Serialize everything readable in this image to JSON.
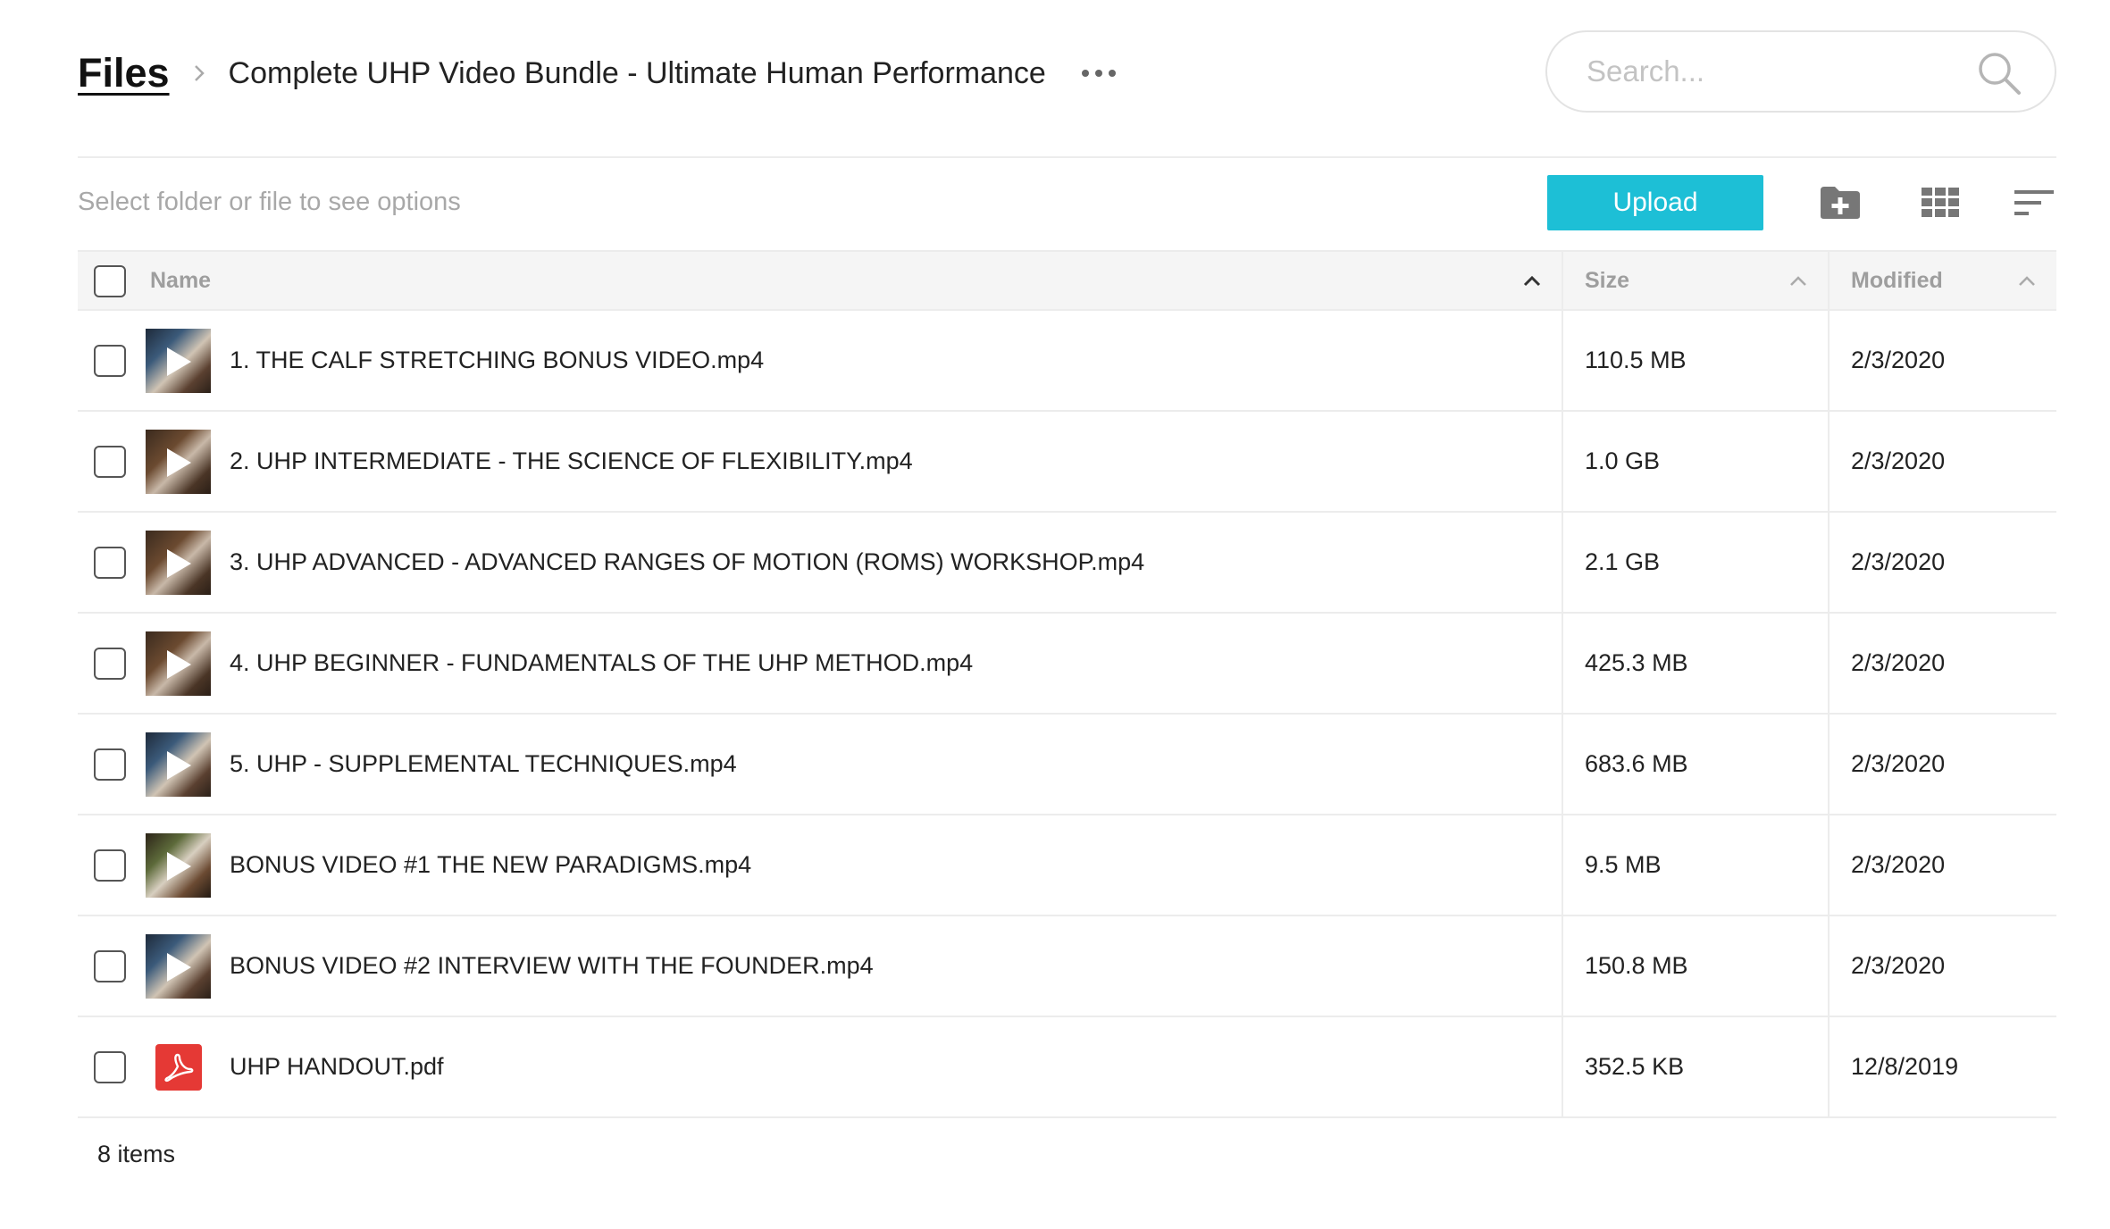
{
  "breadcrumb": {
    "root": "Files",
    "current": "Complete UHP Video Bundle - Ultimate Human Performance"
  },
  "search": {
    "placeholder": "Search..."
  },
  "toolbar": {
    "hint": "Select folder or file to see options",
    "upload_label": "Upload",
    "icons": [
      "new-folder-icon",
      "grid-view-icon",
      "sort-icon"
    ]
  },
  "table": {
    "columns": {
      "name": "Name",
      "size": "Size",
      "modified": "Modified"
    },
    "rows": [
      {
        "name": "1. THE CALF STRETCHING BONUS VIDEO.mp4",
        "size": "110.5 MB",
        "modified": "2/3/2020",
        "type": "video"
      },
      {
        "name": "2. UHP INTERMEDIATE - THE SCIENCE OF FLEXIBILITY.mp4",
        "size": "1.0 GB",
        "modified": "2/3/2020",
        "type": "video"
      },
      {
        "name": "3. UHP ADVANCED - ADVANCED RANGES OF MOTION (ROMS) WORKSHOP.mp4",
        "size": "2.1 GB",
        "modified": "2/3/2020",
        "type": "video"
      },
      {
        "name": "4. UHP BEGINNER - FUNDAMENTALS OF THE UHP METHOD.mp4",
        "size": "425.3 MB",
        "modified": "2/3/2020",
        "type": "video"
      },
      {
        "name": "5. UHP - SUPPLEMENTAL TECHNIQUES.mp4",
        "size": "683.6 MB",
        "modified": "2/3/2020",
        "type": "video"
      },
      {
        "name": "BONUS VIDEO #1 THE NEW PARADIGMS.mp4",
        "size": "9.5 MB",
        "modified": "2/3/2020",
        "type": "video"
      },
      {
        "name": "BONUS VIDEO #2 INTERVIEW WITH THE FOUNDER.mp4",
        "size": "150.8 MB",
        "modified": "2/3/2020",
        "type": "video"
      },
      {
        "name": "UHP HANDOUT.pdf",
        "size": "352.5 KB",
        "modified": "12/8/2019",
        "type": "pdf"
      }
    ]
  },
  "footer": {
    "count": "8 items"
  },
  "colors": {
    "accent": "#1dbfd6",
    "pdf": "#e53935"
  }
}
